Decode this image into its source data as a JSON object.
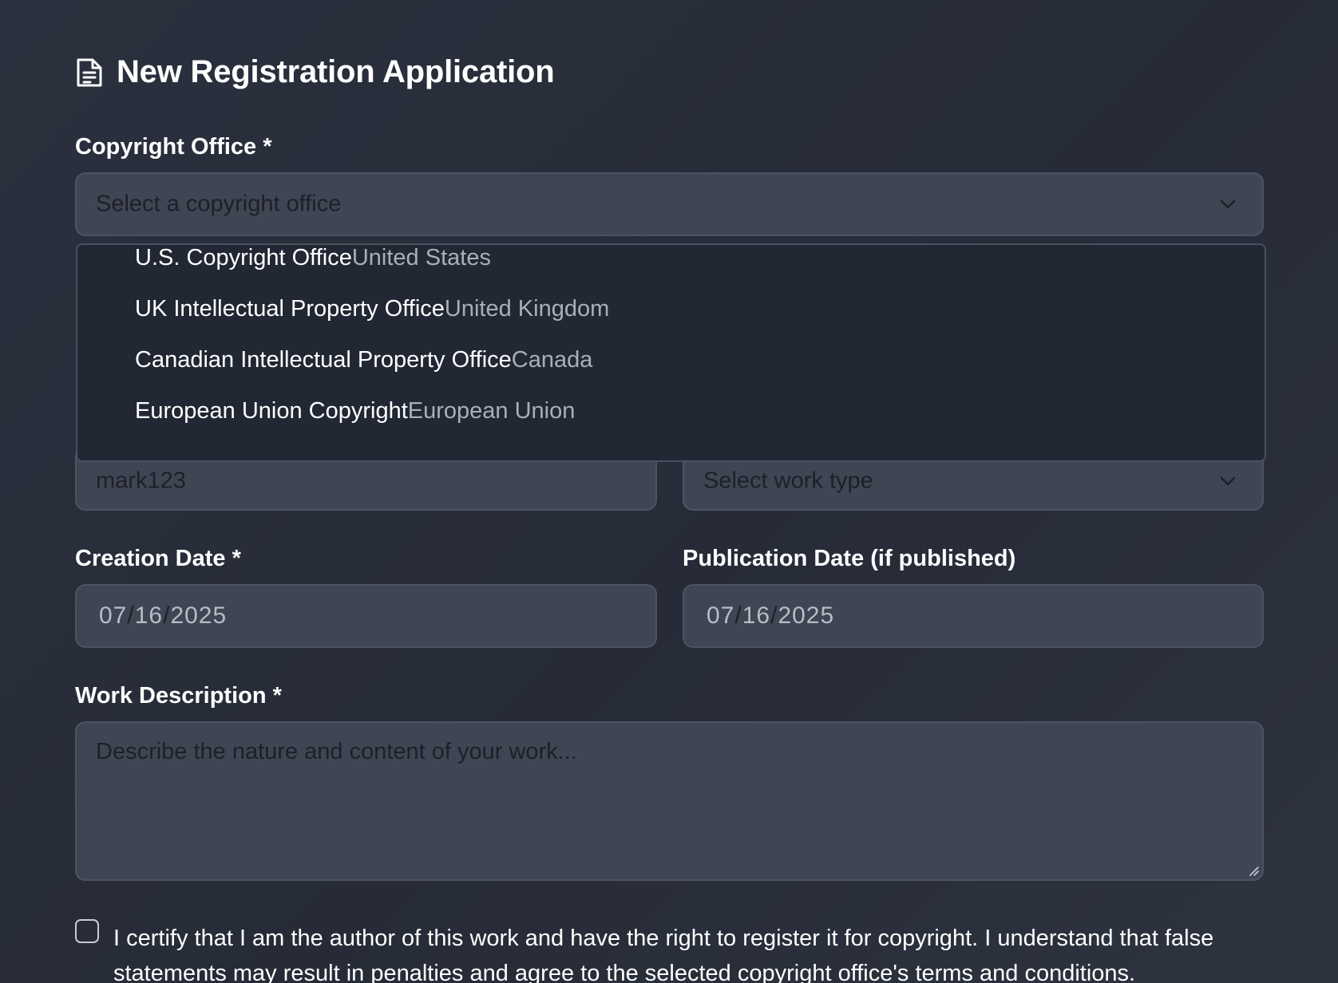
{
  "header": {
    "icon": "document-icon",
    "title": "New Registration Application"
  },
  "copyright_office": {
    "label": "Copyright Office *",
    "placeholder": "Select a copyright office",
    "options": [
      {
        "name": "U.S. Copyright Office",
        "country": "United States"
      },
      {
        "name": "UK Intellectual Property Office",
        "country": "United Kingdom"
      },
      {
        "name": "Canadian Intellectual Property Office",
        "country": "Canada"
      },
      {
        "name": "European Union Copyright",
        "country": "European Union"
      }
    ]
  },
  "partially_hidden_row": {
    "left_value": "mark123",
    "work_type_placeholder": "Select work type"
  },
  "creation_date": {
    "label": "Creation Date *",
    "month": "07",
    "day": "16",
    "year": "2025"
  },
  "publication_date": {
    "label": "Publication Date (if published)",
    "month": "07",
    "day": "16",
    "year": "2025"
  },
  "work_description": {
    "label": "Work Description *",
    "placeholder": "Describe the nature and content of your work..."
  },
  "certification": {
    "checked": false,
    "text": "I certify that I am the author of this work and have the right to register it for copyright. I understand that false statements may result in penalties and agree to the selected copyright office's terms and conditions."
  },
  "colors": {
    "background": "#272c38",
    "field_background": "#3f4553",
    "dropdown_background": "#222734",
    "text_primary": "#ffffff",
    "text_secondary": "#a9afba"
  }
}
